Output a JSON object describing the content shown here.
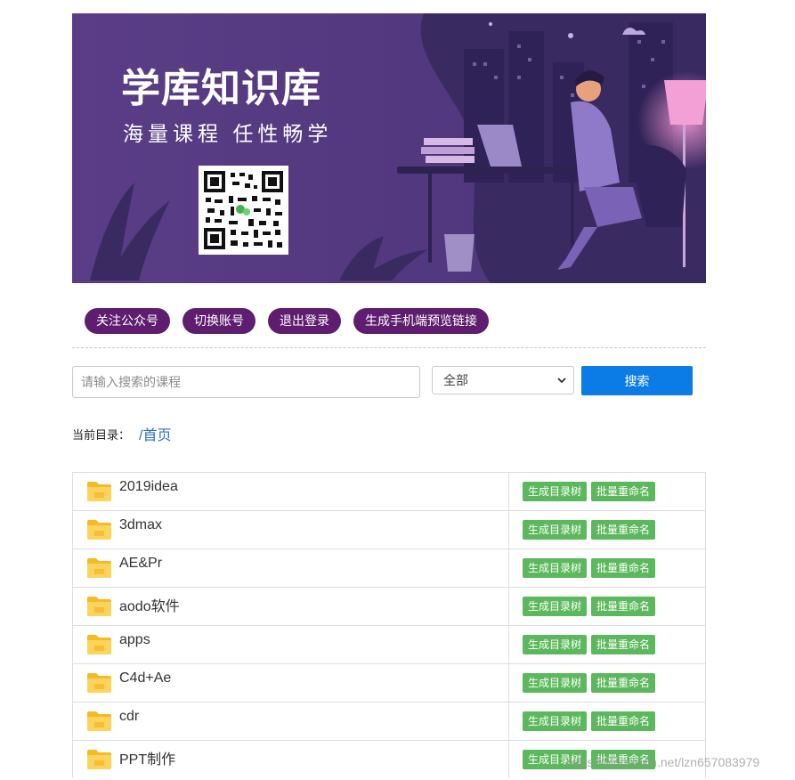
{
  "banner": {
    "title": "学库知识库",
    "subtitle": "海量课程 任性畅学"
  },
  "actions": [
    "关注公众号",
    "切换账号",
    "退出登录",
    "生成手机端预览链接"
  ],
  "search": {
    "placeholder": "请输入搜索的课程",
    "value": "",
    "category": "全部",
    "button": "搜索"
  },
  "breadcrumb": {
    "label": "当前目录：",
    "path": "/首页"
  },
  "row_actions": {
    "tree": "生成目录树",
    "rename": "批量重命名"
  },
  "folders": [
    "2019idea",
    "3dmax",
    "AE&Pr",
    "aodo软件",
    "apps",
    "C4d+Ae",
    "cdr",
    "PPT制作"
  ],
  "watermark": "https://blog.csdn.net/lzn657083979",
  "colors": {
    "banner_bg": "#5b3f86",
    "pill": "#5e1d6e",
    "search_button": "#0b7be6",
    "tag": "#5cb85c",
    "folder": "#fbc93d",
    "link": "#2a6fc0"
  }
}
